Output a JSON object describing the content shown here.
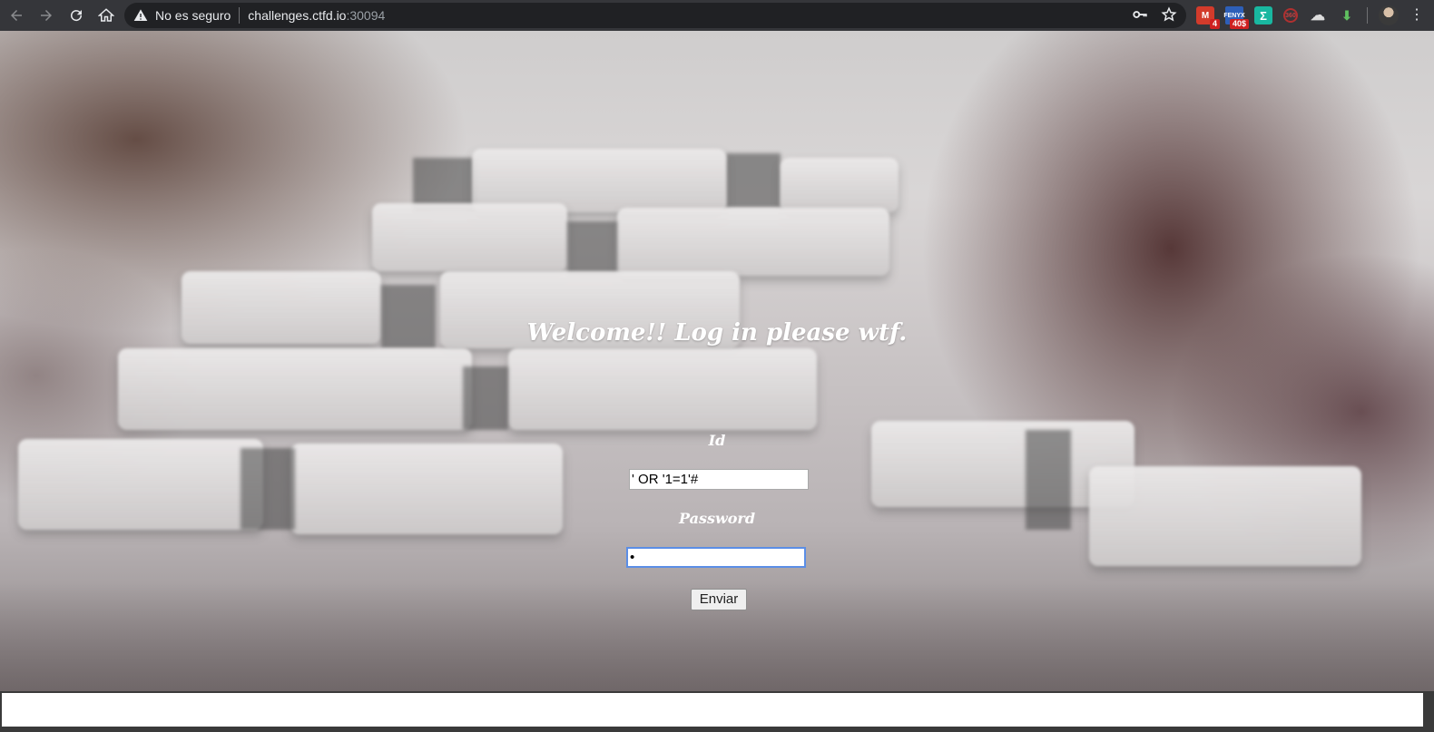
{
  "browser": {
    "security_label": "No es seguro",
    "url_host": "challenges.ctfd.io",
    "url_port": ":30094",
    "icons": {
      "back": "back-arrow-icon",
      "forward": "forward-arrow-icon",
      "reload": "reload-icon",
      "home": "home-icon",
      "warning": "warning-icon",
      "key": "key-icon",
      "star": "star-icon"
    },
    "extensions": [
      {
        "name": "gmail-extension-icon",
        "badge": "4"
      },
      {
        "name": "fenyx-extension-icon",
        "badge": "40$"
      },
      {
        "name": "sigma-extension-icon"
      },
      {
        "name": "360-extension-icon"
      },
      {
        "name": "cloud-extension-icon"
      },
      {
        "name": "download-extension-icon"
      }
    ]
  },
  "page": {
    "title": "Welcome!! Log in please wtf.",
    "id_label": "Id",
    "id_value": "' OR '1=1'#",
    "password_label": "Password",
    "password_value": "•",
    "submit_label": "Enviar"
  },
  "colors": {
    "toolbar": "#35363a",
    "omnibox": "#202124",
    "focus_ring": "#5b8ee6",
    "title_text": "#ffffff"
  }
}
